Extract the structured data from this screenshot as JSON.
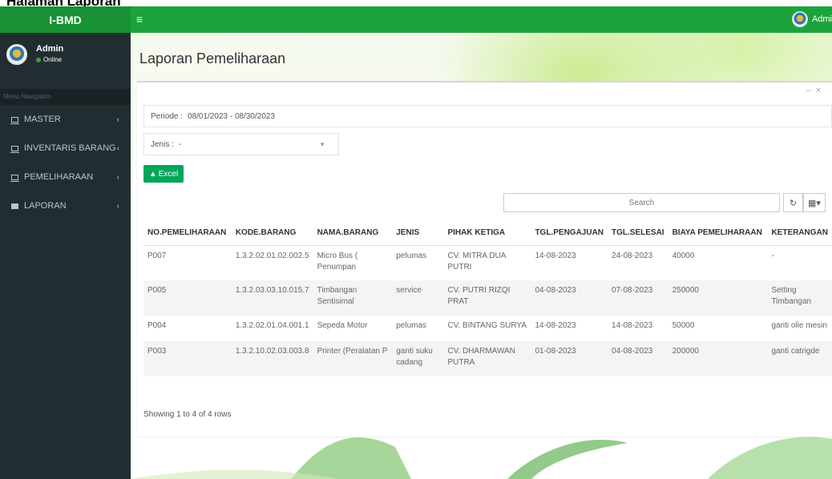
{
  "caption": "Halaman Laporan",
  "app": {
    "brand": "I-BMD",
    "top_user": "Admi"
  },
  "colors": {
    "topbar": "#1ba33b",
    "sidebar": "#222d32",
    "excel": "#00a65a"
  },
  "sidebar": {
    "user_name": "Admin",
    "user_status": "Online",
    "nav_header": "Menu Navigation",
    "items": [
      {
        "label": "MASTER",
        "icon": "monitor-icon"
      },
      {
        "label": "INVENTARIS BARANG",
        "icon": "monitor-icon"
      },
      {
        "label": "PEMELIHARAAN",
        "icon": "monitor-icon"
      },
      {
        "label": "LAPORAN",
        "icon": "envelope-icon"
      }
    ]
  },
  "page": {
    "title": "Laporan Pemeliharaan"
  },
  "filters": {
    "periode_label": "Periode :",
    "periode_value": "08/01/2023 - 08/30/2023",
    "jenis_label": "Jenis :",
    "jenis_value": "-"
  },
  "toolbar": {
    "excel_label": "Excel",
    "search_placeholder": "Search",
    "refresh_icon": "refresh-icon",
    "columns_icon": "columns-grid-icon"
  },
  "table": {
    "headers": [
      "NO.PEMELIHARAAN",
      "KODE.BARANG",
      "NAMA.BARANG",
      "JENIS",
      "PIHAK KETIGA",
      "TGL.PENGAJUAN",
      "TGL.SELESAI",
      "BIAYA PEMELIHARAAN",
      "KETERANGAN"
    ],
    "rows": [
      [
        "P007",
        "1.3.2.02.01.02.002.5",
        "Micro Bus ( Penumpan",
        "pelumas",
        "CV. MITRA DUA PUTRI",
        "14-08-2023",
        "24-08-2023",
        "40000",
        "-"
      ],
      [
        "P005",
        "1.3.2.03.03.10.015.7",
        "Timbangan Sentisimal",
        "service",
        "CV. PUTRI RIZQI PRAT",
        "04-08-2023",
        "07-08-2023",
        "250000",
        "Setting Timbangan"
      ],
      [
        "P004",
        "1.3.2.02.01.04.001.1",
        "Sepeda Motor",
        "pelumas",
        "CV. BINTANG SURYA",
        "14-08-2023",
        "14-08-2023",
        "50000",
        "ganti olie mesin"
      ],
      [
        "P003",
        "1.3.2.10.02.03.003.8",
        "Printer (Peralatan P",
        "ganti suku cadang",
        "CV. DHARMAWAN PUTRA",
        "01-08-2023",
        "04-08-2023",
        "200000",
        "ganti catrigde"
      ]
    ],
    "footer": "Showing 1 to 4 of 4 rows"
  }
}
